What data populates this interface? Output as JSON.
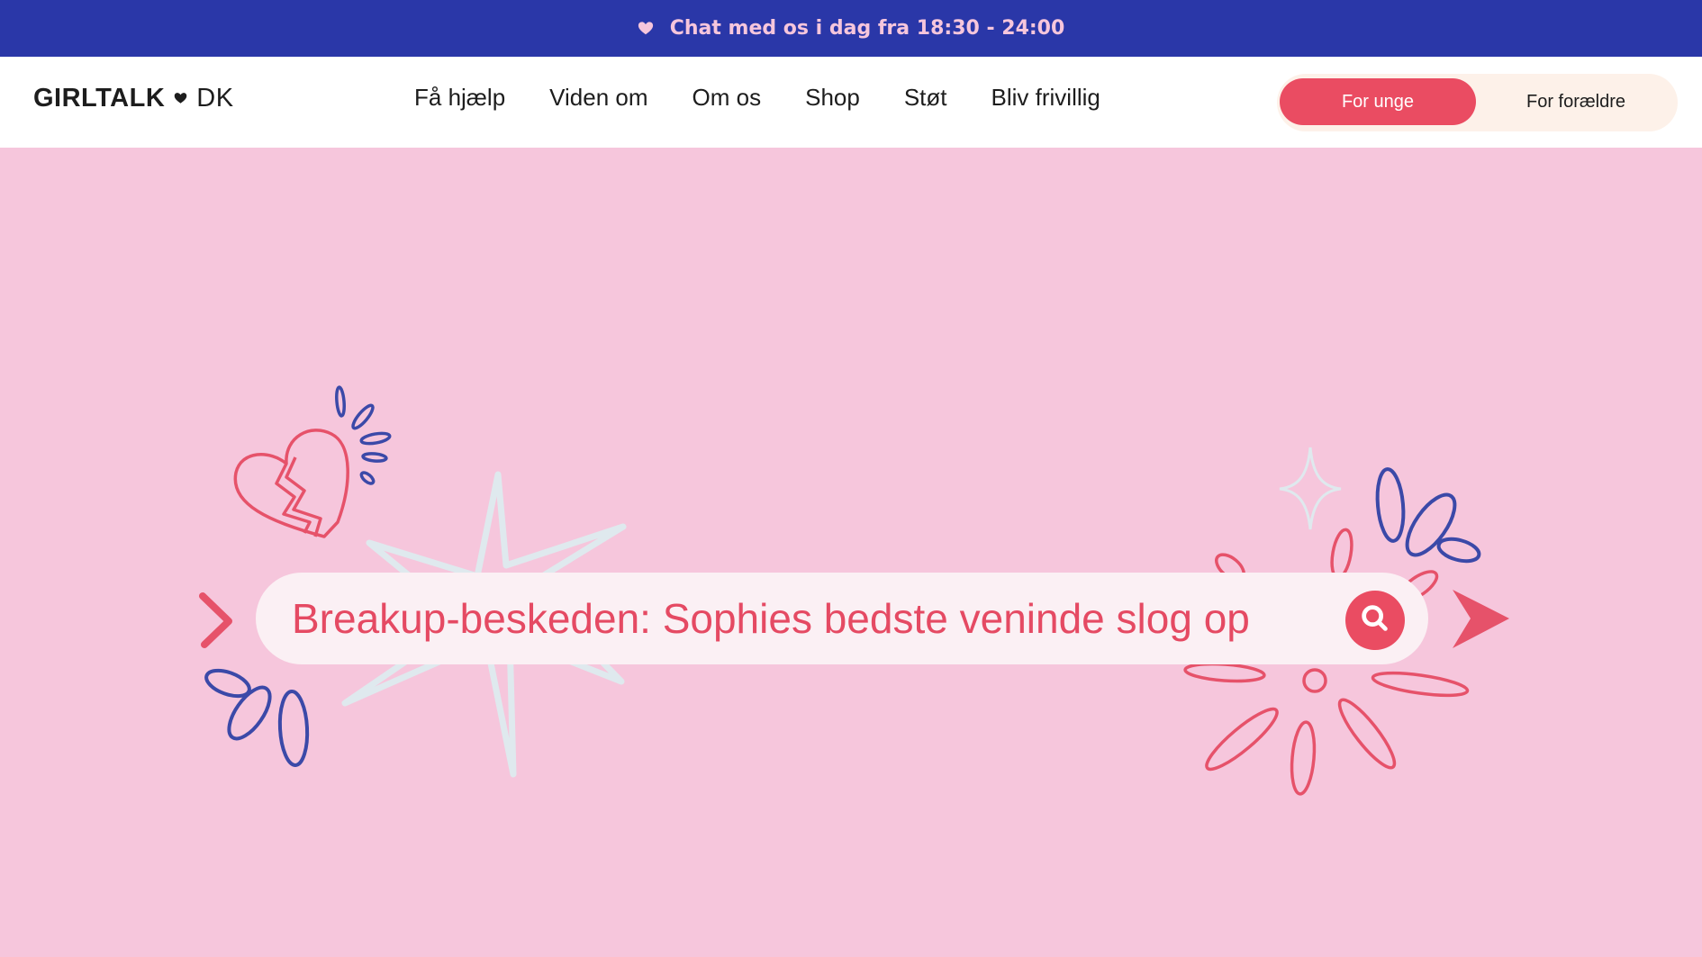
{
  "announcement": {
    "icon": "heart-icon",
    "text": "Chat med os i dag fra 18:30 - 24:00"
  },
  "header": {
    "logo": {
      "brand": "GIRLTALK",
      "suffix": "DK",
      "icon": "heart-icon"
    },
    "nav": [
      {
        "label": "Få hjælp"
      },
      {
        "label": "Viden om"
      },
      {
        "label": "Om os"
      },
      {
        "label": "Shop"
      },
      {
        "label": "Støt"
      },
      {
        "label": "Bliv frivillig"
      }
    ],
    "audience": {
      "active": "For unge",
      "inactive": "For forældre"
    }
  },
  "hero": {
    "search_text": "Breakup-beskeden: Sophies bedste veninde slog op",
    "search_icon": "search-icon"
  },
  "colors": {
    "topbar": "#2a37a8",
    "background": "#f6c6dc",
    "accent_red": "#ea4c62",
    "accent_blue": "#3b49a8",
    "sparkle": "#dfe9ee"
  }
}
